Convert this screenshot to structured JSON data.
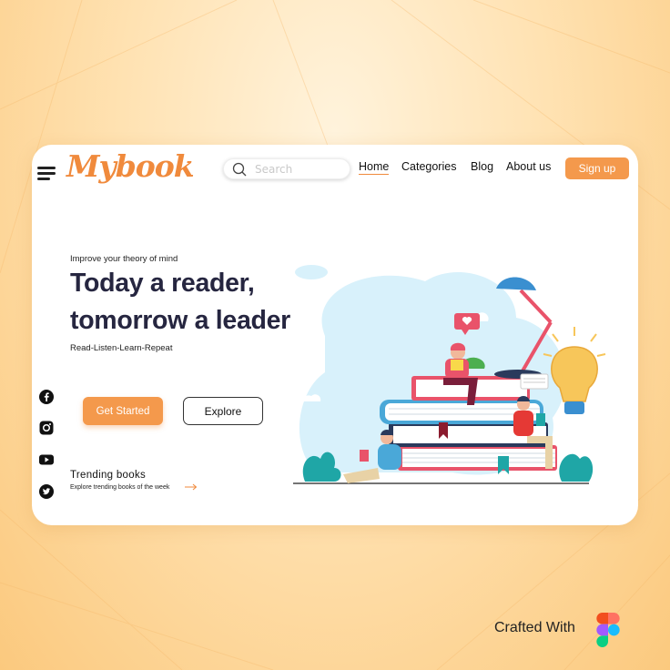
{
  "brand": {
    "logo_text": "Mybook",
    "accent_color": "#f08a3c",
    "button_color": "#f4994c"
  },
  "header": {
    "search_placeholder": "Search",
    "nav": [
      {
        "label": "Home",
        "active": true
      },
      {
        "label": "Categories",
        "active": false
      },
      {
        "label": "Blog",
        "active": false
      },
      {
        "label": "About us",
        "active": false
      }
    ],
    "signup_label": "Sign up"
  },
  "hero": {
    "eyebrow": "Improve your theory of mind",
    "headline_line1": "Today a reader,",
    "headline_line2": "tomorrow a leader",
    "tagline": "Read-Listen-Learn-Repeat",
    "primary_button": "Get Started",
    "secondary_button": "Explore"
  },
  "social_icons": [
    "facebook-icon",
    "instagram-icon",
    "youtube-icon",
    "twitter-icon"
  ],
  "trending": {
    "title": "Trending books",
    "subtitle": "Explore trending books of the week"
  },
  "footer": {
    "crafted_label": "Crafted With",
    "tool_icon": "figma-icon"
  }
}
